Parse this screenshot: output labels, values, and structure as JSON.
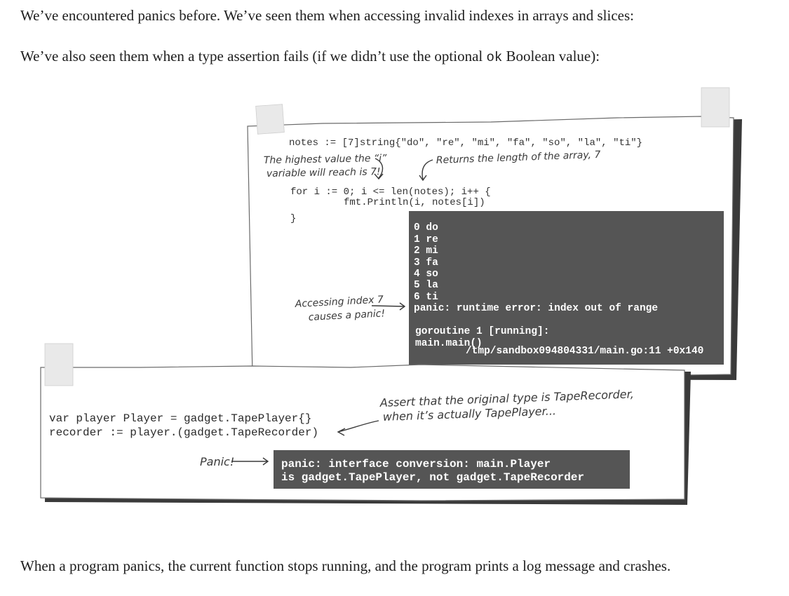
{
  "intro": {
    "line1": "We’ve encountered panics before. We’ve seen them when accessing invalid indexes in arrays and slices:",
    "line2_before": "We’ve also seen them when a type assertion fails (if we didn’t use the optional ",
    "line2_code": "ok",
    "line2_after": " Boolean value):"
  },
  "figure_array": {
    "code": [
      "notes := [7]string{\"do\", \"re\", \"mi\", \"fa\", \"so\", \"la\", \"ti\"}",
      "for i := 0; i <= len(notes); i++ {",
      "fmt.Println(i, notes[i])",
      "}"
    ],
    "note_highest_line1": "The highest value the “i”",
    "note_highest_line2": "variable will reach is 7!",
    "note_length": "Returns the length of the array, 7",
    "note_panic_line1": "Accessing index 7",
    "note_panic_line2": "causes a panic!",
    "output": [
      "0 do",
      "1 re",
      "2 mi",
      "3 fa",
      "4 so",
      "5 la",
      "6 ti",
      "panic: runtime error: index out of range",
      "goroutine 1 [running]:",
      "main.main()",
      "/tmp/sandbox094804331/main.go:11 +0x140"
    ]
  },
  "figure_assert": {
    "code": [
      "var player Player = gadget.TapePlayer{}",
      "recorder := player.(gadget.TapeRecorder)"
    ],
    "note_assert_line1": "Assert that the original type is TapeRecorder,",
    "note_assert_line2": "when it’s actually TapePlayer...",
    "note_panic": "Panic!",
    "output": [
      "panic: interface conversion: main.Player",
      "is gadget.TapePlayer, not gadget.TapeRecorder"
    ]
  },
  "outro": {
    "line": "When a program panics, the current function stops running, and the program prints a log message and crashes."
  }
}
